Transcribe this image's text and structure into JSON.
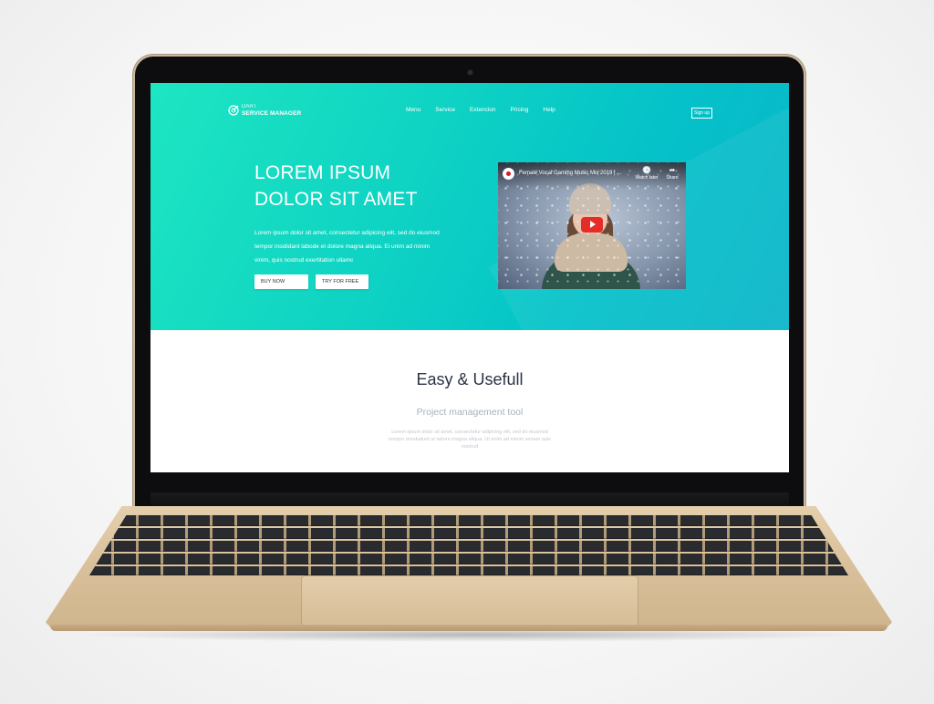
{
  "brand": {
    "line1": "DART",
    "line2": "SERVICE MANAGER"
  },
  "nav": [
    "Menu",
    "Service",
    "Extencion",
    "Pricing",
    "Help"
  ],
  "signup": "Sign up",
  "hero": {
    "title_line1": "LOREM IPSUM",
    "title_line2": "DOLOR SIT AMET",
    "text": "Lorem ipsum dolor sit amet, consectetur adipicing elit, sed do eiusmod tempor insididant labode et dolore magna aliqua. Ei unim ad minim vinim, quis nostrud exertitation ullamc",
    "buy_button": "BUY NOW",
    "try_button": "TRY FOR FREE"
  },
  "video": {
    "title": "Female Vocal Gaming Music Mix 2019 | ...",
    "watch_later": "Watch later",
    "share": "Share",
    "icons": {
      "watch_later": "clock-icon",
      "share": "share-arrow-icon",
      "play": "play-icon"
    }
  },
  "section": {
    "title": "Easy & Usefull",
    "subtitle": "Project management tool",
    "text": "Lorem ipsum dolor sit amet, consectetur adipicing elit, sed do eiusmod tempor enodudunt ut labore magna aliqua. Ut enim ad minim venam quis nostrud"
  },
  "colors": {
    "hero_start": "#1de6c2",
    "hero_end": "#0ab5c9",
    "laptop_gold": "#d9c09a",
    "play_red": "#e52d27"
  }
}
